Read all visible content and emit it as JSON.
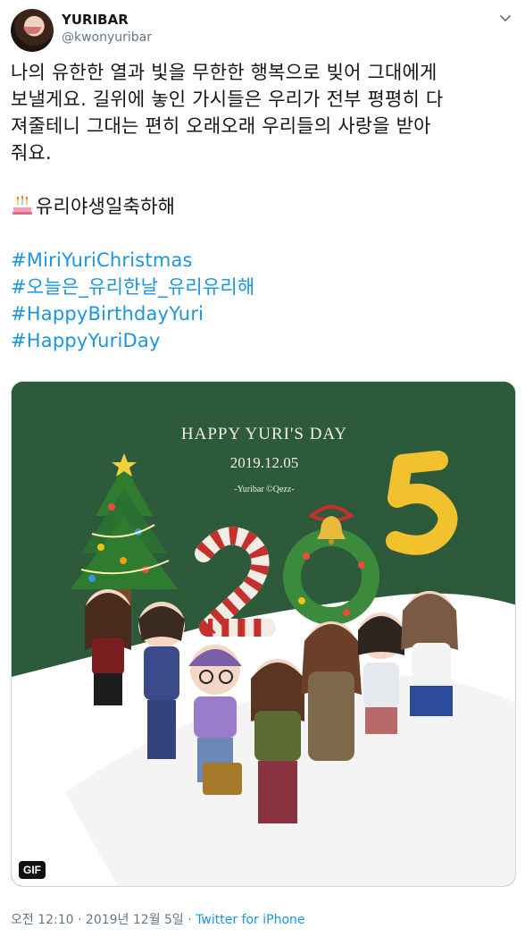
{
  "user": {
    "display_name": "YURIBAR",
    "handle": "@kwonyuribar"
  },
  "tweet": {
    "lines": [
      "나의 유한한 열과 빛을 무한한 행복으로 빚어 그대에게",
      "보낼게요. 길위에 놓인 가시들은 우리가 전부 평평히 다",
      "져줄테니 그대는 편히 오래오래 우리들의 사랑을 받아",
      "줘요."
    ],
    "birthday_line": "유리야생일축하해",
    "hashtags": [
      "#MiriYuriChristmas",
      "#오늘은_유리한날_유리유리해",
      "#HappyBirthdayYuri",
      "#HappyYuriDay"
    ]
  },
  "media": {
    "card_title": "HAPPY YURI'S DAY",
    "card_date": "2019.12.05",
    "card_credit": "-Yuribar ©Qezz-",
    "big_number_2": "2",
    "big_number_5": "5",
    "badge": "GIF",
    "colors": {
      "background": "#2c5a3a",
      "snow": "#ffffff",
      "accent_gold": "#f2c12e",
      "accent_red": "#c4302b"
    }
  },
  "meta": {
    "time": "오전 12:10",
    "separator": "·",
    "date": "2019년 12월 5일",
    "source": "Twitter for iPhone"
  },
  "icons": [
    "avatar",
    "chevron-down-icon",
    "birthday-cake-icon",
    "christmas-tree-icon",
    "bell-icon",
    "wreath-icon"
  ]
}
